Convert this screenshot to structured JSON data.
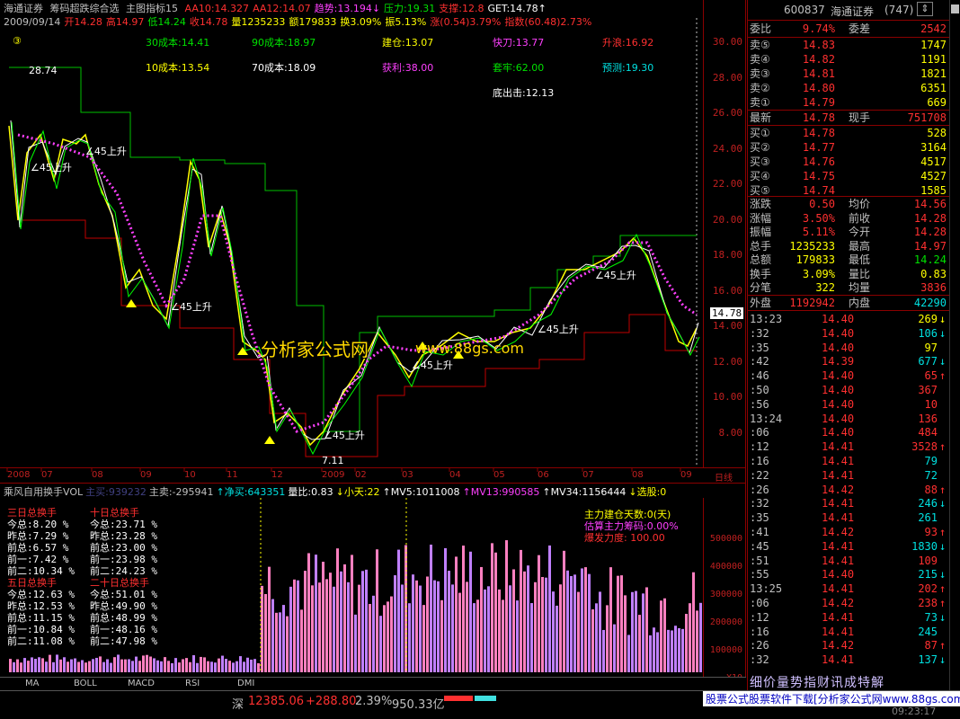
{
  "header": {
    "app_name": "海通证券",
    "indicator": "筹码超跌综合选",
    "template": "主图指标15",
    "items": [
      {
        "text": "AA10:14.327",
        "color": "#ff3030"
      },
      {
        "text": "AA12:14.07",
        "color": "#ff3030"
      },
      {
        "text": "趋势:13.194↓",
        "color": "#ff40ff"
      },
      {
        "text": "压力:19.31",
        "color": "#00e000"
      },
      {
        "text": "支撑:12.8",
        "color": "#ff3030"
      },
      {
        "text": "GET:14.78↑",
        "color": "#ffffff"
      }
    ],
    "row2": [
      {
        "text": "2009/09/14",
        "color": "#c0c0c0"
      },
      {
        "text": "开14.28",
        "color": "#ff3030"
      },
      {
        "text": "高14.97",
        "color": "#ff3030"
      },
      {
        "text": "低14.24",
        "color": "#00e000"
      },
      {
        "text": "收14.78",
        "color": "#ff3030"
      },
      {
        "text": "量1235233",
        "color": "#ffff00"
      },
      {
        "text": "额179833",
        "color": "#ffff00"
      },
      {
        "text": "换3.09%",
        "color": "#ffff00"
      },
      {
        "text": "振5.13%",
        "color": "#ffff00"
      },
      {
        "text": "涨(0.54)3.79%",
        "color": "#ff3030"
      },
      {
        "text": "指数(60.48)2.73%",
        "color": "#ff3030"
      }
    ]
  },
  "cost_labels": [
    {
      "text": "③",
      "color": "#ffff00",
      "pos": "a"
    },
    {
      "text": "30成本:14.41",
      "color": "#00e000",
      "pos": "b"
    },
    {
      "text": "90成本:18.97",
      "color": "#00e000",
      "pos": "c"
    },
    {
      "text": "建仓:13.07",
      "color": "#ffff00",
      "pos": "d"
    },
    {
      "text": "快刀:13.77",
      "color": "#ff40ff",
      "pos": "e"
    },
    {
      "text": "升浪:16.92",
      "color": "#ff3030",
      "pos": "f"
    },
    {
      "text": "10成本:13.54",
      "color": "#ffff00",
      "pos": "g"
    },
    {
      "text": "70成本:18.09",
      "color": "#ffffff",
      "pos": "h"
    },
    {
      "text": "获利:38.00",
      "color": "#ff40ff",
      "pos": "i"
    },
    {
      "text": "套牢:62.00",
      "color": "#00e000",
      "pos": "j"
    },
    {
      "text": "预测:19.30",
      "color": "#00e0e0",
      "pos": "k"
    },
    {
      "text": "底出击:12.13",
      "color": "#ffffff",
      "pos": "l"
    }
  ],
  "chart_data": {
    "type": "line",
    "price_axis": [
      "30.00",
      "28.00",
      "26.00",
      "24.00",
      "22.00",
      "20.00",
      "18.00",
      "16.00",
      "14.00",
      "12.00",
      "10.00",
      "8.00"
    ],
    "current_price": "14.78",
    "date_labels": [
      "2008",
      "07",
      "08",
      "09",
      "10",
      "11",
      "12",
      "2009",
      "02",
      "03",
      "04",
      "05",
      "06",
      "07",
      "08",
      "09",
      "日线"
    ],
    "annotations": [
      "28.74",
      "7.11",
      "∠45上升"
    ]
  },
  "watermark": "分析家公式网",
  "watermark_url": "www.88gs.com",
  "volume": {
    "header": [
      {
        "text": "乘风自用换手VOL",
        "color": "#c0c0c0"
      },
      {
        "text": "主买:939232",
        "color": "#404080"
      },
      {
        "text": "主卖:-295941",
        "color": "#c0c0c0"
      },
      {
        "text": "↑净买:643351",
        "color": "#00e0e0"
      },
      {
        "text": "量比:0.83",
        "color": "#ffffff"
      },
      {
        "text": "↓小天:22",
        "color": "#ffff00"
      },
      {
        "text": "↑MV5:1011008",
        "color": "#ffffff"
      },
      {
        "text": "↑MV13:990585",
        "color": "#ff40ff"
      },
      {
        "text": "↑MV34:1156444",
        "color": "#ffffff"
      },
      {
        "text": "↓选股:0",
        "color": "#ffff00"
      }
    ],
    "axis": [
      "500000",
      "400000",
      "300000",
      "200000",
      "100000",
      "X10"
    ],
    "turnover_left": {
      "title1": "三日总换手",
      "rows1": [
        "今总:8.20 %",
        "昨总:7.29 %",
        "前总:6.57 %",
        "前一:7.42 %",
        "前二:10.34 %"
      ],
      "title2": "五日总换手",
      "rows2": [
        "今总:12.63 %",
        "昨总:12.53 %",
        "前总:11.15 %",
        "前一:10.84 %",
        "前二:11.08 %"
      ]
    },
    "turnover_right": {
      "title1": "十日总换手",
      "rows1": [
        "今总:23.71 %",
        "昨总:23.28 %",
        "前总:23.00 %",
        "前一:23.98 %",
        "前二:24.23 %"
      ],
      "title2": "二十日总换手",
      "rows2": [
        "今总:51.01 %",
        "昨总:49.90 %",
        "前总:48.99 %",
        "前一:48.16 %",
        "前二:47.98 %"
      ]
    },
    "legend": [
      {
        "text": "主力建仓天数:0(天)",
        "color": "#ffff00"
      },
      {
        "text": "估算主力筹码:0.00%",
        "color": "#ff40ff"
      },
      {
        "text": "爆发力度: 100.00",
        "color": "#ff3030"
      }
    ]
  },
  "tabs": [
    "MA",
    "BOLL",
    "MACD",
    "RSI",
    "DMI"
  ],
  "status": {
    "market": "深",
    "index": "12385.06",
    "change": "+288.80",
    "pct": "2.39%",
    "amount": "950.33亿",
    "ad": "股票公式股票软件下载[分析家公式网www.88gs.com]",
    "time": "09:23:17"
  },
  "right_panel": {
    "code": "600837",
    "name": "海通证券",
    "num": "(747)",
    "weibi_label": "委比",
    "weibi_value": "9.74%",
    "weicha_label": "委差",
    "weicha_value": "2542",
    "asks": [
      {
        "label": "卖⑤",
        "price": "14.83",
        "vol": "1747"
      },
      {
        "label": "卖④",
        "price": "14.82",
        "vol": "1191"
      },
      {
        "label": "卖③",
        "price": "14.81",
        "vol": "1821"
      },
      {
        "label": "卖②",
        "price": "14.80",
        "vol": "6351"
      },
      {
        "label": "卖①",
        "price": "14.79",
        "vol": "669"
      }
    ],
    "last_label": "最新",
    "last_price": "14.78",
    "hand_label": "现手",
    "hand_value": "751708",
    "bids": [
      {
        "label": "买①",
        "price": "14.78",
        "vol": "528"
      },
      {
        "label": "买②",
        "price": "14.77",
        "vol": "3164"
      },
      {
        "label": "买③",
        "price": "14.76",
        "vol": "4517"
      },
      {
        "label": "买④",
        "price": "14.75",
        "vol": "4527"
      },
      {
        "label": "买⑤",
        "price": "14.74",
        "vol": "1585"
      }
    ],
    "stats": [
      {
        "l1": "涨跌",
        "v1": "0.50",
        "l2": "均价",
        "v2": "14.56"
      },
      {
        "l1": "涨幅",
        "v1": "3.50%",
        "l2": "前收",
        "v2": "14.28"
      },
      {
        "l1": "振幅",
        "v1": "5.11%",
        "l2": "今开",
        "v2": "14.28"
      },
      {
        "l1": "总手",
        "v1": "1235233",
        "l2": "最高",
        "v2": "14.97"
      },
      {
        "l1": "总额",
        "v1": "179833",
        "l2": "最低",
        "v2": "14.24"
      },
      {
        "l1": "换手",
        "v1": "3.09%",
        "l2": "量比",
        "v2": "0.83"
      },
      {
        "l1": "分笔",
        "v1": "322",
        "l2": "均量",
        "v2": "3836"
      }
    ],
    "outer_label": "外盘",
    "outer_value": "1192942",
    "inner_label": "内盘",
    "inner_value": "42290",
    "ticks": [
      {
        "t": "13:23",
        "p": "14.40",
        "v": "269",
        "d": "↓",
        "c": "#ffff00"
      },
      {
        "t": ":32",
        "p": "14.40",
        "v": "106",
        "d": "↓",
        "c": "#00e0e0"
      },
      {
        "t": ":35",
        "p": "14.40",
        "v": "97",
        "d": "",
        "c": "#ffff00"
      },
      {
        "t": ":42",
        "p": "14.39",
        "v": "677",
        "d": "↓",
        "c": "#00e0e0"
      },
      {
        "t": ":46",
        "p": "14.40",
        "v": "65",
        "d": "↑",
        "c": "#ff3030"
      },
      {
        "t": ":50",
        "p": "14.40",
        "v": "367",
        "d": "",
        "c": "#ff3030"
      },
      {
        "t": ":56",
        "p": "14.40",
        "v": "10",
        "d": "",
        "c": "#ff3030"
      },
      {
        "t": "13:24",
        "p": "14.40",
        "v": "136",
        "d": "",
        "c": "#ff3030"
      },
      {
        "t": ":06",
        "p": "14.40",
        "v": "484",
        "d": "",
        "c": "#ff3030"
      },
      {
        "t": ":12",
        "p": "14.41",
        "v": "3528",
        "d": "↑",
        "c": "#ff3030"
      },
      {
        "t": ":16",
        "p": "14.41",
        "v": "79",
        "d": "",
        "c": "#00e0e0"
      },
      {
        "t": ":22",
        "p": "14.41",
        "v": "72",
        "d": "",
        "c": "#00e0e0"
      },
      {
        "t": ":26",
        "p": "14.42",
        "v": "88",
        "d": "↑",
        "c": "#ff3030"
      },
      {
        "t": ":32",
        "p": "14.41",
        "v": "246",
        "d": "↓",
        "c": "#00e0e0"
      },
      {
        "t": ":35",
        "p": "14.41",
        "v": "261",
        "d": "",
        "c": "#00e0e0"
      },
      {
        "t": ":41",
        "p": "14.42",
        "v": "93",
        "d": "↑",
        "c": "#ff3030"
      },
      {
        "t": ":45",
        "p": "14.41",
        "v": "1830",
        "d": "↓",
        "c": "#00e0e0"
      },
      {
        "t": ":51",
        "p": "14.41",
        "v": "109",
        "d": "",
        "c": "#ff3030"
      },
      {
        "t": ":55",
        "p": "14.40",
        "v": "215",
        "d": "↓",
        "c": "#00e0e0"
      },
      {
        "t": "13:25",
        "p": "14.41",
        "v": "202",
        "d": "↑",
        "c": "#ff3030"
      },
      {
        "t": ":06",
        "p": "14.42",
        "v": "238",
        "d": "↑",
        "c": "#ff3030"
      },
      {
        "t": ":12",
        "p": "14.41",
        "v": "73",
        "d": "↓",
        "c": "#00e0e0"
      },
      {
        "t": ":16",
        "p": "14.41",
        "v": "245",
        "d": "",
        "c": "#00e0e0"
      },
      {
        "t": ":26",
        "p": "14.42",
        "v": "87",
        "d": "↑",
        "c": "#ff3030"
      },
      {
        "t": ":32",
        "p": "14.41",
        "v": "137",
        "d": "↓",
        "c": "#00e0e0"
      }
    ],
    "bottom_buttons": "细价量势指财讯成特解"
  }
}
